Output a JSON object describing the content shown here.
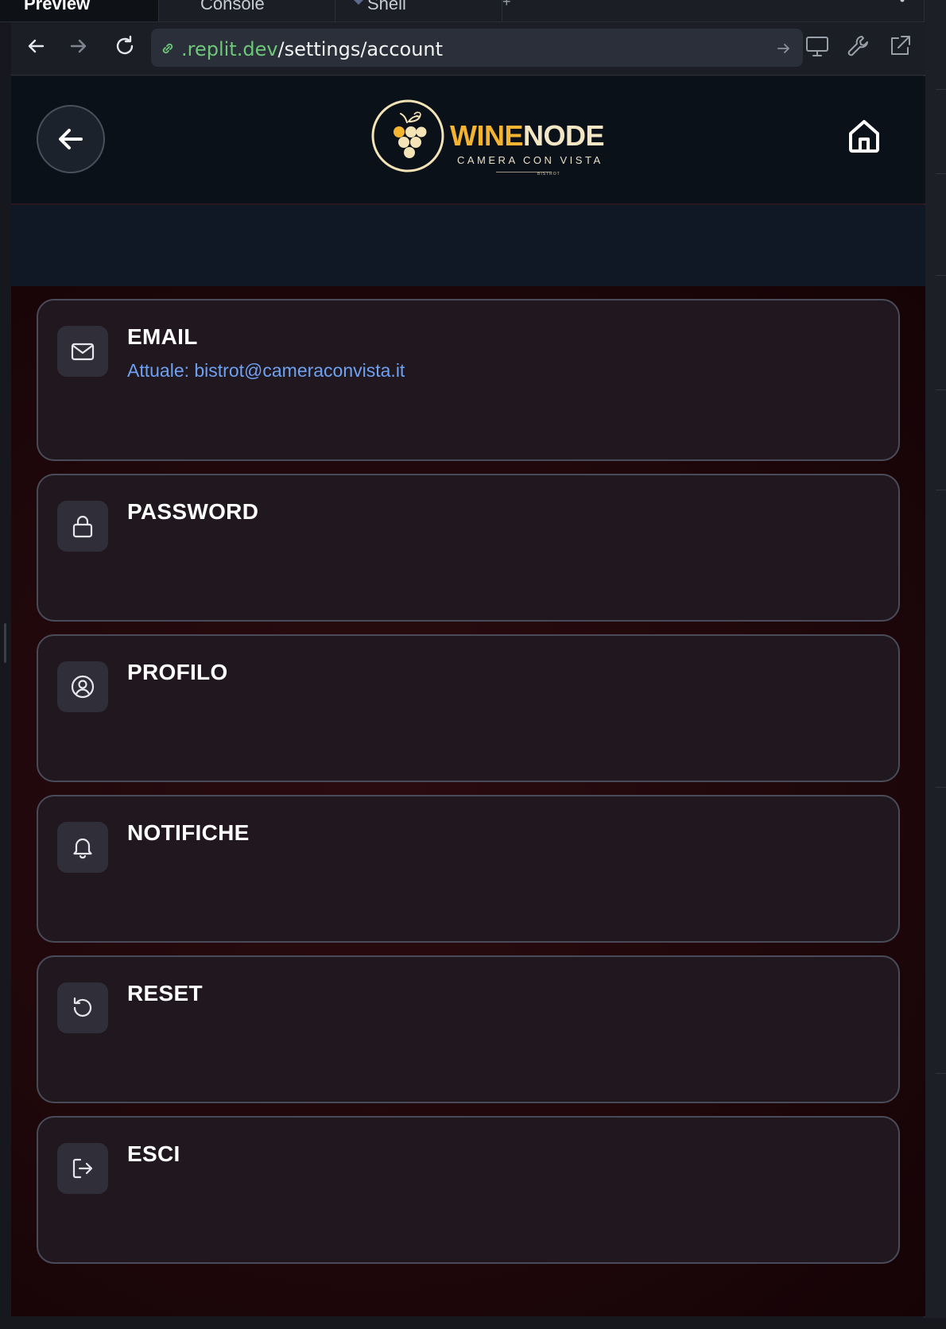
{
  "ide": {
    "tabs": [
      {
        "label": "Preview",
        "active": true
      },
      {
        "label": "Console",
        "active": false
      },
      {
        "label": "Shell",
        "active": false
      }
    ]
  },
  "browser": {
    "url_domain": ".replit.dev",
    "url_path": "/settings/account"
  },
  "header": {
    "logo_word_wine": "WINE",
    "logo_word_node": "NODE",
    "logo_subtitle": "CAMERA CON VISTA",
    "logo_tiny": "BISTROT"
  },
  "settings": {
    "cards": [
      {
        "title": "EMAIL",
        "subtitle": "Attuale: bistrot@cameraconvista.it",
        "icon": "mail-icon"
      },
      {
        "title": "PASSWORD",
        "icon": "lock-icon"
      },
      {
        "title": "PROFILO",
        "icon": "user-circle-icon"
      },
      {
        "title": "NOTIFICHE",
        "icon": "bell-icon"
      },
      {
        "title": "RESET",
        "icon": "reset-icon"
      },
      {
        "title": "ESCI",
        "icon": "logout-icon"
      }
    ]
  },
  "colors": {
    "accent_link": "#6ea1f1",
    "logo_gold": "#f4b331",
    "url_domain_green": "#6ec77a",
    "card_background": "#21171f",
    "card_border": "#4a4b59"
  }
}
